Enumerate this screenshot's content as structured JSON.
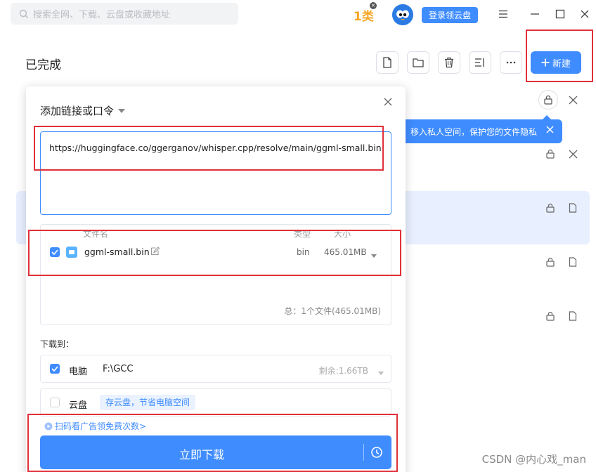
{
  "topbar": {
    "search_placeholder": "搜索全网、下载、云盘或收藏地址",
    "badge_text": "1类",
    "login_button": "登录领云盘"
  },
  "header": {
    "title": "已完成",
    "new_button": "新建"
  },
  "tooltip": {
    "text": "移入私人空间，保护您的文件隐私"
  },
  "dialog": {
    "title": "添加链接或口令",
    "url": "https://huggingface.co/ggerganov/whisper.cpp/resolve/main/ggml-small.bin",
    "columns": {
      "name": "文件名",
      "type": "类型",
      "size": "大小"
    },
    "files": [
      {
        "name": "ggml-small.bin",
        "type": "bin",
        "size": "465.01MB",
        "checked": true
      }
    ],
    "total": "总：1个文件(465.01MB)",
    "download_to_label": "下载到：",
    "locations": [
      {
        "label": "电脑",
        "path": "F:\\GCC",
        "free": "剩余:1.66TB",
        "checked": true
      },
      {
        "label": "云盘",
        "tip": "存云盘，节省电脑空间",
        "checked": false
      }
    ],
    "ad_link": "扫码看广告领免费次数>",
    "download_button": "立即下载"
  },
  "watermark": "CSDN @内心戏_man",
  "colors": {
    "accent": "#3f8cff",
    "highlight_border": "#e0303a",
    "row_highlight": "#e8efff"
  }
}
